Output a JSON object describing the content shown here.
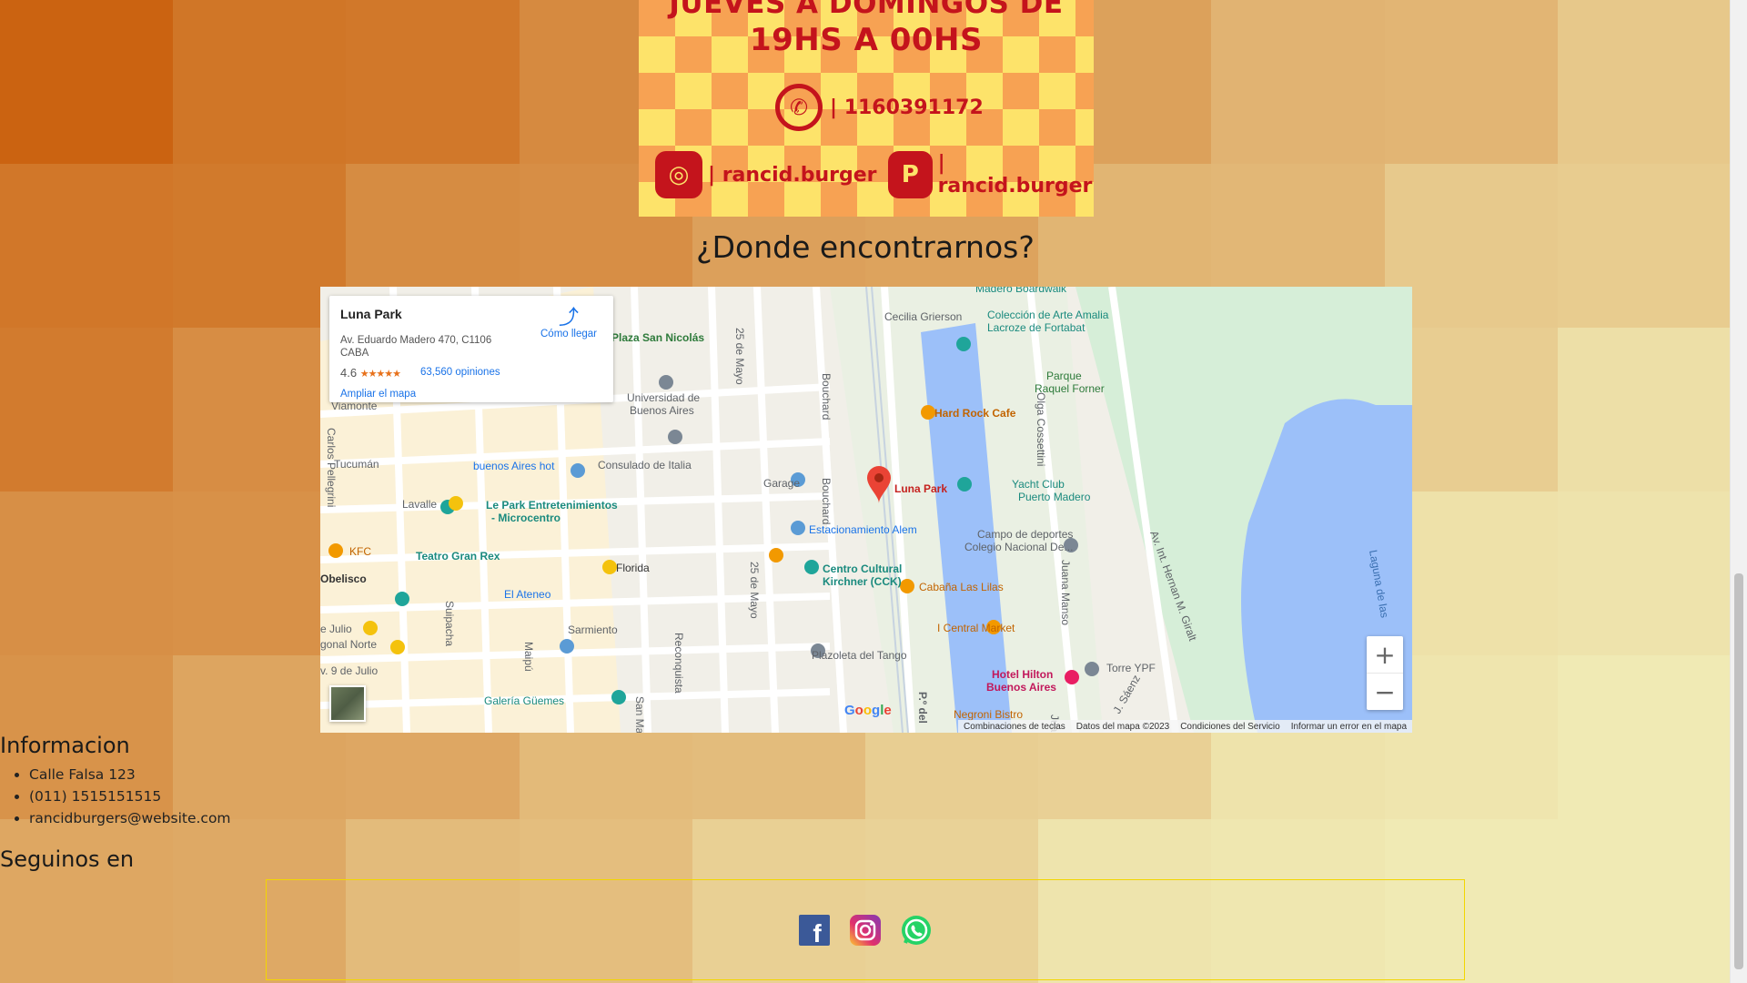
{
  "flyer": {
    "line1": "JUEVES A DOMINGOS DE",
    "line2": "19HS A 00HS",
    "whatsapp_number": "| 1160391172",
    "instagram_handle": "| rancid.burger",
    "pedidosya_handle": "| rancid.burger",
    "red": "#c4141c",
    "yellow": "#fde36a"
  },
  "section_title": "¿Donde encontrarnos?",
  "map": {
    "place_name": "Luna Park",
    "address": "Av. Eduardo Madero 470, C1106 CABA",
    "rating": "4.6",
    "stars": "★★★★★",
    "reviews": "63,560 opiniones",
    "enlarge": "Ampliar el mapa",
    "directions": "Cómo llegar",
    "zoom_in": "+",
    "zoom_out": "−",
    "google": "Google",
    "footer": {
      "shortcuts": "Combinaciones de teclas",
      "data": "Datos del mapa ©2023",
      "terms": "Condiciones del Servicio",
      "report": "Informar un error en el mapa"
    },
    "labels": {
      "cecilia": "Cecilia Grierson",
      "coleccion": "Colección de Arte Amalia",
      "coleccion2": "Lacroze de Fortabat",
      "parque": "Parque",
      "parque2": "Raquel Forner",
      "plaza": "Plaza San Nicolás",
      "uba": "Universidad de",
      "uba2": "Buenos Aires",
      "hardrock": "Hard Rock Cafe",
      "viamonte": "Viamonte",
      "tucuman": "Tucumán",
      "bahot": "buenos Aires hot",
      "consulado": "Consulado de Italia",
      "garage": "Garage",
      "lunapark": "Luna Park",
      "yacht": "Yacht Club",
      "yacht2": "Puerto Madero",
      "lavalle": "Lavalle",
      "lepark": "Le Park Entretenimientos",
      "lepark2": "- Microcentro",
      "estacionamiento": "Estacionamiento Alem",
      "campo": "Campo de deportes",
      "campo2": "Colegio Nacional De...",
      "kfc": "KFC",
      "obelisco": "Obelisco",
      "granrex": "Teatro Gran Rex",
      "florida": "Florida",
      "cck": "Centro Cultural",
      "cck2": "Kirchner (CCK)",
      "lilas": "Cabaña Las Lilas",
      "ateneo": "El Ateneo",
      "central": "I Central Market",
      "julio": "e Julio",
      "sarmiento": "Sarmiento",
      "norte": "gonal Norte",
      "plazoleta": "Plazoleta del Tango",
      "torre": "Torre YPF",
      "nueve": "v. 9 de Julio",
      "guemes": "Galería Güemes",
      "hilton": "Hotel Hilton",
      "hilton2": "Buenos Aires",
      "negroni": "Negroni Bistro",
      "veinticinco": "25 de Mayo",
      "veinticinco2": "25 de Mayo",
      "bouchard": "Bouchard",
      "bouchard2": "Bouchard",
      "olga": "Olga Cossettini",
      "juana": "Juana Manso",
      "giralt": "Av. Int. Hernan M. Giralt",
      "laguna": "Laguna de las",
      "pellegrini": "Carlos Pellegrini",
      "suipacha": "Suipacha",
      "maipu": "Maipú",
      "reconquista": "Reconquista",
      "sanmartin": "San Ma",
      "madero": "Madero Boardwalk",
      "pdel": "P.º del",
      "juan": "Jua",
      "saenz": "J. Sáenz"
    }
  },
  "info": {
    "title": "Informacion",
    "items": [
      "Calle Falsa 123",
      "(011) 1515151515",
      "rancidburgers@website.com"
    ]
  },
  "follow_title": "Seguinos en",
  "social": {
    "facebook": "f",
    "instagram": "◎",
    "whatsapp": "✆"
  }
}
